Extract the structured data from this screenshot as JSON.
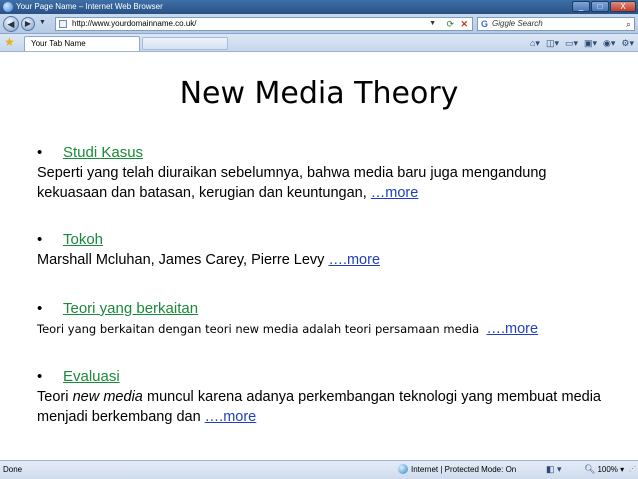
{
  "window": {
    "title": "Your Page Name – Internet Web Browser",
    "controls": {
      "minimize": "_",
      "maximize": "□",
      "close": "X"
    }
  },
  "toolbar": {
    "url": "http://www.yourdomainname.co.uk/",
    "search_placeholder": "Giggle Search",
    "back_glyph": "◀",
    "forward_glyph": "▶"
  },
  "tabs": [
    {
      "label": "Your Tab Name"
    }
  ],
  "main": {
    "title": "New Media Theory",
    "sections": [
      {
        "heading": "Studi Kasus",
        "text": "Seperti yang telah diuraikan sebelumnya, bahwa media baru juga mengandung kekuasaan dan batasan, kerugian dan keuntungan, ",
        "more": "…more"
      },
      {
        "heading": "Tokoh",
        "text": "Marshall Mcluhan, James Carey, Pierre Levy ",
        "more": "….more"
      },
      {
        "heading": "Teori yang berkaitan",
        "text": "Teori yang berkaitan dengan teori new media adalah teori persamaan media ",
        "more": "….more"
      },
      {
        "heading": "Evaluasi",
        "text_a": "Teori ",
        "text_italic": "new media",
        "text_b": " muncul karena adanya perkembangan teknologi yang membuat media menjadi berkembang dan ",
        "more": "….more"
      }
    ]
  },
  "statusbar": {
    "status": "Done",
    "zone": "Internet | Protected Mode: On",
    "zoom": "100%"
  }
}
